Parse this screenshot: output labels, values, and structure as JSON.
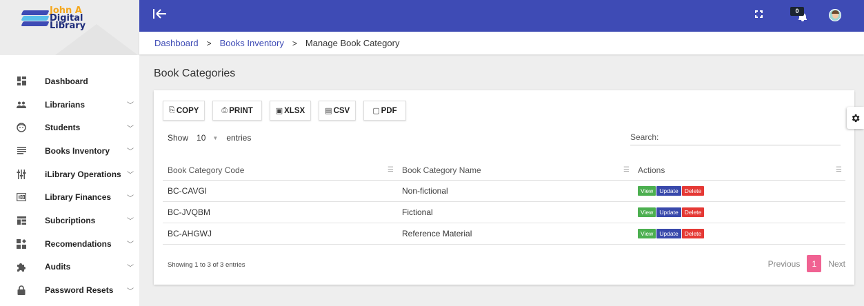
{
  "brand": {
    "logo_line1": "John A",
    "logo_line2": "Digital",
    "logo_line3": "Library"
  },
  "colors": {
    "topbar": "#3e4bb5",
    "view": "#4caf50",
    "update": "#3949ab",
    "delete": "#e53935",
    "active_page": "#f06292"
  },
  "sidebar": {
    "items": [
      {
        "label": "Dashboard",
        "icon": "dashboard-icon",
        "chevron": false
      },
      {
        "label": "Librarians",
        "icon": "people-icon",
        "chevron": true
      },
      {
        "label": "Students",
        "icon": "face-icon",
        "chevron": true
      },
      {
        "label": "Books Inventory",
        "icon": "list-icon",
        "chevron": true
      },
      {
        "label": "iLibrary Operations",
        "icon": "tune-icon",
        "chevron": true
      },
      {
        "label": "Library Finances",
        "icon": "counter-icon",
        "chevron": true
      },
      {
        "label": "Subcriptions",
        "icon": "subscriptions-icon",
        "chevron": true
      },
      {
        "label": "Recomendations",
        "icon": "recommend-icon",
        "chevron": true
      },
      {
        "label": "Audits",
        "icon": "puzzle-icon",
        "chevron": true
      },
      {
        "label": "Password Resets",
        "icon": "lock-icon",
        "chevron": true
      }
    ]
  },
  "topbar": {
    "notification_count": "0"
  },
  "breadcrumb": {
    "items": [
      "Dashboard",
      "Books Inventory"
    ],
    "current": "Manage Book Category"
  },
  "page": {
    "title": "Book Categories"
  },
  "export_buttons": [
    {
      "icon": "⎘",
      "label": "COPY"
    },
    {
      "icon": "⎙",
      "label": "PRINT"
    },
    {
      "icon": "▣",
      "label": "XLSX"
    },
    {
      "icon": "▤",
      "label": "CSV"
    },
    {
      "icon": "▢",
      "label": "PDF"
    }
  ],
  "length": {
    "prefix": "Show",
    "value": "10",
    "suffix": "entries"
  },
  "search": {
    "label": "Search:"
  },
  "table": {
    "columns": [
      "Book Category Code",
      "Book Category Name",
      "Actions"
    ],
    "rows": [
      {
        "code": "BC-CAVGI",
        "name": "Non-fictional"
      },
      {
        "code": "BC-JVQBM",
        "name": "Fictional"
      },
      {
        "code": "BC-AHGWJ",
        "name": "Reference Material"
      }
    ],
    "actions": [
      "View",
      "Update",
      "Delete"
    ]
  },
  "footer": {
    "info": "Showing 1 to 3 of 3 entries",
    "previous": "Previous",
    "page": "1",
    "next": "Next"
  }
}
